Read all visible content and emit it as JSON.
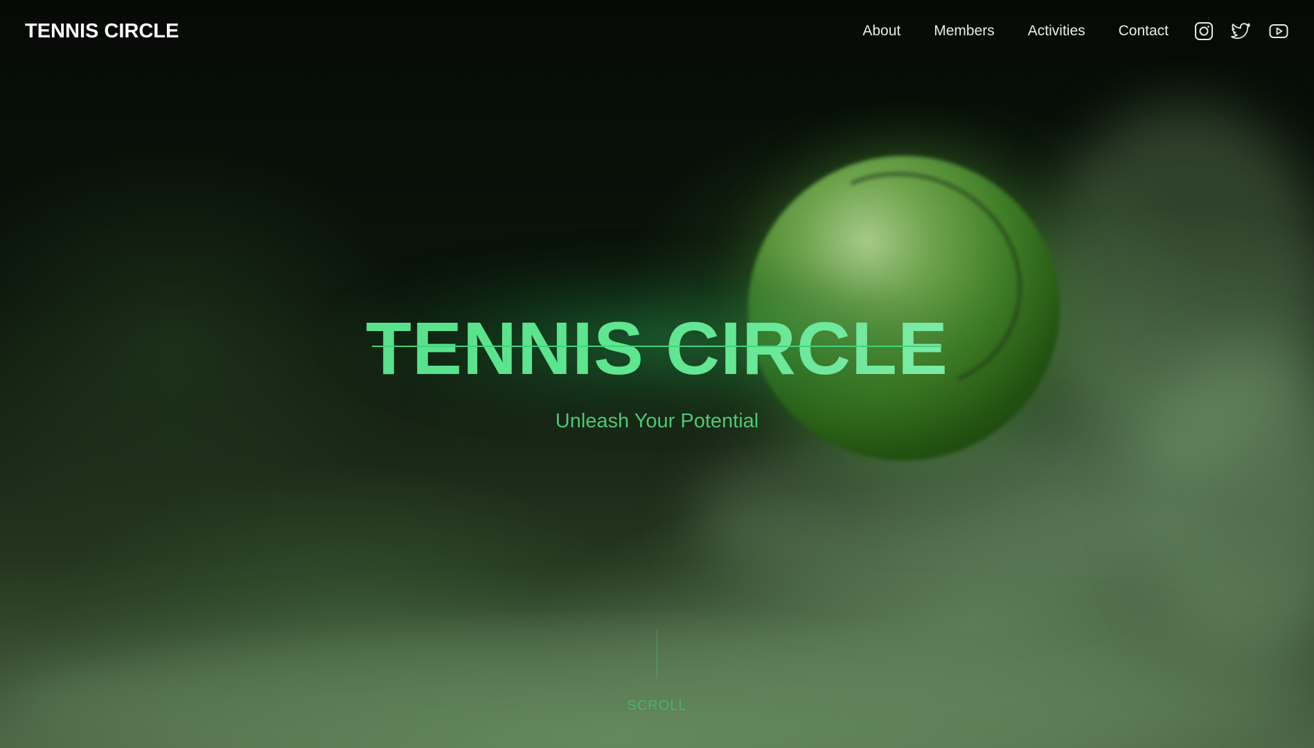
{
  "header": {
    "logo": "TENNIS CIRCLE",
    "nav": [
      {
        "label": "About"
      },
      {
        "label": "Members"
      },
      {
        "label": "Activities"
      },
      {
        "label": "Contact"
      }
    ],
    "social_icons": [
      "instagram-icon",
      "twitter-icon",
      "youtube-icon"
    ]
  },
  "hero": {
    "title": "TENNIS CIRCLE",
    "subtitle": "Unleash Your Potential",
    "scroll_label": "SCROLL"
  },
  "colors": {
    "accent_green": "#5fe691",
    "subtitle_green": "#4fc877",
    "header_bg": "#080a08",
    "text_white": "#ffffff"
  }
}
